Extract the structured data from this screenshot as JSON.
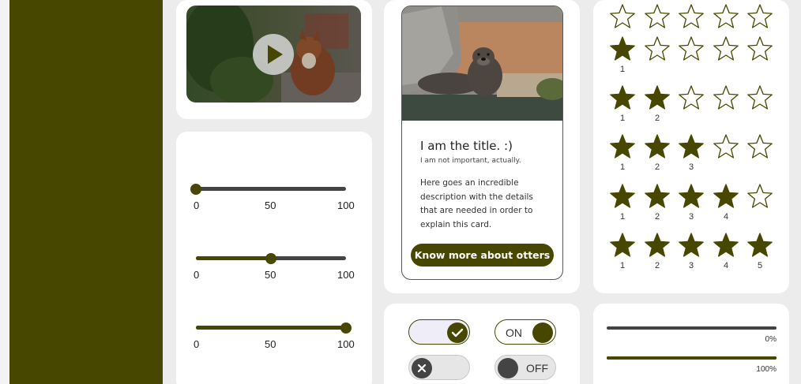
{
  "colors": {
    "accent": "#474700",
    "track": "#444444",
    "toggle_on_bg": "#efeef8",
    "toggle_off_bg": "#e6e6e6"
  },
  "video": {
    "play_icon": "play-icon"
  },
  "sliders": [
    {
      "value": 0,
      "min_label": "0",
      "mid_label": "50",
      "max_label": "100"
    },
    {
      "value": 50,
      "min_label": "0",
      "mid_label": "50",
      "max_label": "100"
    },
    {
      "value": 100,
      "min_label": "0",
      "mid_label": "50",
      "max_label": "100"
    }
  ],
  "otter_card": {
    "title": "I am the title. :)",
    "subtitle": "I am not important, actually.",
    "description": "Here goes an incredible description with the details that are needed in order to explain this card.",
    "button_label": "Know more about otters"
  },
  "ratings": [
    {
      "value": 0,
      "labels": []
    },
    {
      "value": 1,
      "labels": [
        "1"
      ]
    },
    {
      "value": 2,
      "labels": [
        "1",
        "2"
      ]
    },
    {
      "value": 3,
      "labels": [
        "1",
        "2",
        "3"
      ]
    },
    {
      "value": 4,
      "labels": [
        "1",
        "2",
        "3",
        "4"
      ]
    },
    {
      "value": 5,
      "labels": [
        "1",
        "2",
        "3",
        "4",
        "5"
      ]
    }
  ],
  "toggles": {
    "check_toggle": {
      "checked": true,
      "icon": "check-icon"
    },
    "on_toggle": {
      "checked": true,
      "label": "ON"
    },
    "x_toggle": {
      "checked": false,
      "icon": "close-icon"
    },
    "off_toggle": {
      "checked": false,
      "label": "OFF"
    }
  },
  "progress": [
    {
      "value": 0,
      "label": "0%"
    },
    {
      "value": 1,
      "label": "100%"
    }
  ]
}
